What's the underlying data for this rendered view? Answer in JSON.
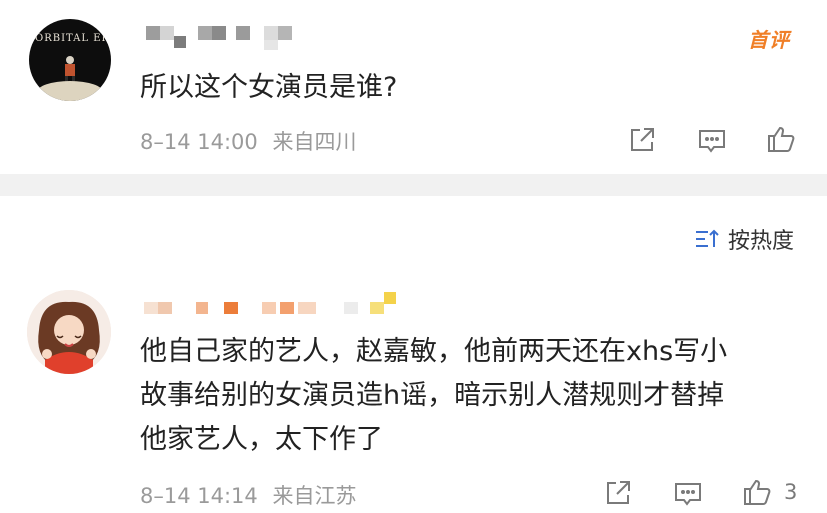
{
  "comments": [
    {
      "avatar_text": "ORBITAL ERA",
      "badge": "首评",
      "text": "所以这个女演员是谁?",
      "time": "8–14 14:00",
      "location": "来自四川",
      "like_count": ""
    },
    {
      "text_lines": [
        "他自己家的艺人，赵嘉敏，他前两天还在xhs写小",
        "故事给别的女演员造h谣，暗示别人潜规则才替掉",
        "他家艺人，太下作了"
      ],
      "time": "8–14 14:14",
      "location": "来自江苏",
      "like_count": "3"
    }
  ],
  "sort": {
    "label": "按热度"
  },
  "icons": {
    "share": "share-icon",
    "comment": "comment-icon",
    "like": "thumbs-up-icon",
    "sort": "sort-icon"
  },
  "colors": {
    "accent": "#f07f27",
    "meta": "#9a9a9a",
    "divider": "#f1f1f1"
  }
}
